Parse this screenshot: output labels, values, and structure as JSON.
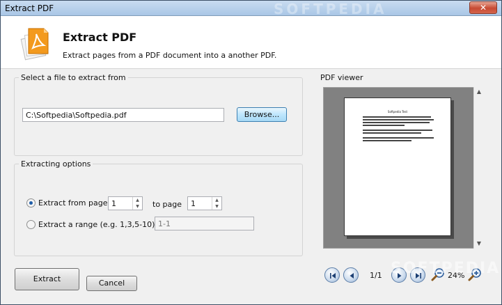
{
  "window": {
    "title": "Extract PDF",
    "watermark": "SOFTPEDIA",
    "close_label": "✕"
  },
  "header": {
    "title": "Extract PDF",
    "description": "Extract pages from a PDF document into a another PDF.",
    "icon": "pdf-document-icon"
  },
  "file_group": {
    "legend": "Select a file to extract from",
    "file_path": "C:\\Softpedia\\Softpedia.pdf",
    "browse_label": "Browse..."
  },
  "options_group": {
    "legend": "Extracting options",
    "from_page_label": "Extract from page",
    "from_page_value": "1",
    "to_page_label": "to page",
    "to_page_value": "1",
    "range_label": "Extract a range (e.g. 1,3,5-10)",
    "range_placeholder": "1-1",
    "selected_option": "from_page"
  },
  "viewer": {
    "legend": "PDF viewer",
    "page_title": "Softpedia Test",
    "page_indicator": "1/1",
    "zoom_level": "24%"
  },
  "buttons": {
    "extract_label": "Extract",
    "cancel_label": "Cancel"
  },
  "colors": {
    "accent": "#3c7fb1",
    "viewer_bg": "#818181",
    "close_red": "#c74a33"
  }
}
